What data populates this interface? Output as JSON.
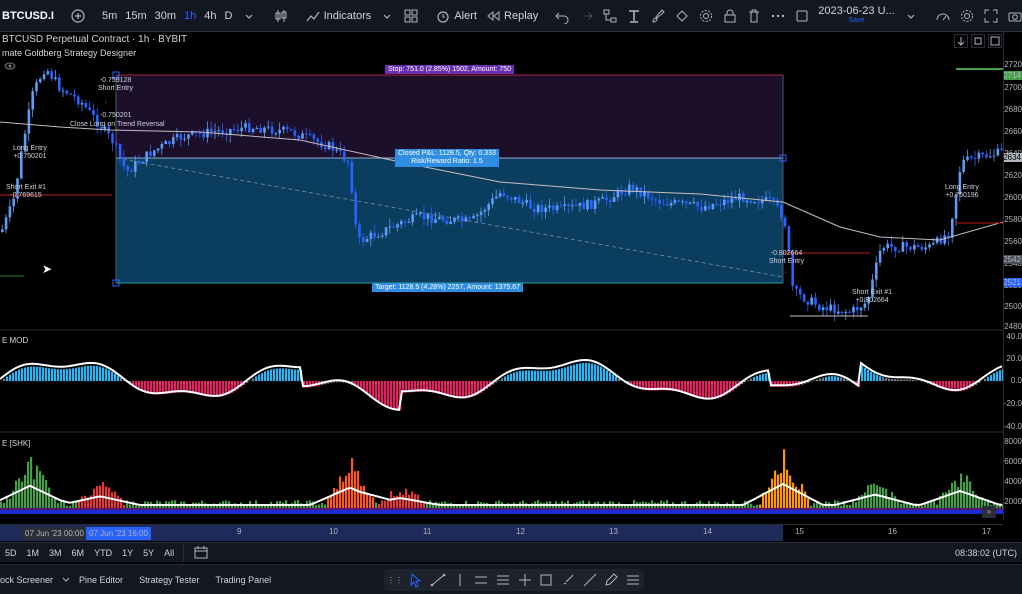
{
  "toolbar": {
    "symbol": "BTCUSD.I",
    "timeframes": [
      "5m",
      "15m",
      "30m",
      "1h",
      "4h",
      "D"
    ],
    "active_timeframe": "1h",
    "indicators_label": "Indicators",
    "alert_label": "Alert",
    "replay_label": "Replay",
    "datetime": "2023-06-23 U...",
    "save_label": "Save"
  },
  "legend": {
    "main_title": "BTCUSD Perpetual Contract · 1h · BYBIT",
    "strategy_name": "mate Goldberg Strategy Designer",
    "osc1_name": "E MOD",
    "osc2_name": "E [SHK]"
  },
  "trade_box": {
    "stop_label": "Stop: 751.0 (2.85%) 1502, Amount: 750",
    "closed_pnl": "Closed P&L: 1128.5, Qty: 0.333",
    "rr": "Risk/Reward Ratio: 1.5",
    "target_label": "Target: 1128.5 (4.28%) 2257, Amount: 1375.67"
  },
  "annotations": [
    {
      "id": "a1",
      "lines": [
        "-0.759128",
        "Short Entry"
      ]
    },
    {
      "id": "a2",
      "lines": [
        "-0.750201"
      ]
    },
    {
      "id": "a3",
      "lines": [
        "Close Long on Trend Reversal"
      ]
    },
    {
      "id": "a4",
      "lines": [
        "Long Entry",
        "+0.750201"
      ]
    },
    {
      "id": "a5",
      "lines": [
        "Short Exit #1",
        "-0.769615"
      ]
    },
    {
      "id": "a6",
      "lines": [
        "-0.802664",
        "Short Entry"
      ]
    },
    {
      "id": "a7",
      "lines": [
        "Short Exit #1",
        "+0.802664"
      ]
    },
    {
      "id": "a8",
      "lines": [
        "Long Entry",
        "+0.760196"
      ]
    }
  ],
  "price_axis": {
    "labels": [
      "2720",
      "2700",
      "2680",
      "2660",
      "2640",
      "2620",
      "2600",
      "2580",
      "2560",
      "2540",
      "2520",
      "2500",
      "2480"
    ],
    "osc1_labels": [
      "40.0",
      "20.0",
      "0.0",
      "-20.0",
      "-40.0"
    ],
    "osc2_labels": [
      "8000",
      "6000",
      "4000",
      "2000"
    ],
    "tag_green": "2714",
    "tag_price": "2634",
    "tag_grey": "2542",
    "tag_blue": "2521"
  },
  "time_axis": {
    "labels": [
      "9",
      "10",
      "11",
      "12",
      "13",
      "14",
      "15",
      "16",
      "17"
    ],
    "range_start": "07 Jun '23   00:00",
    "range_end": "07 Jun '23   16:00"
  },
  "range_bar": {
    "ranges": [
      "5D",
      "1M",
      "3M",
      "6M",
      "YTD",
      "1Y",
      "5Y",
      "All"
    ],
    "clock": "08:38:02 (UTC)"
  },
  "bottom_tabs": [
    "ock Screener",
    "Pine Editor",
    "Strategy Tester",
    "Trading Panel"
  ],
  "colors": {
    "up": "#5b9cf6",
    "down": "#2962ff",
    "stop_zone": "#1c0f2a",
    "target_zone": "#0b3e5e",
    "hist_pos": "#29b6f6",
    "hist_neg": "#e91e63",
    "accent": "#2962ff"
  }
}
